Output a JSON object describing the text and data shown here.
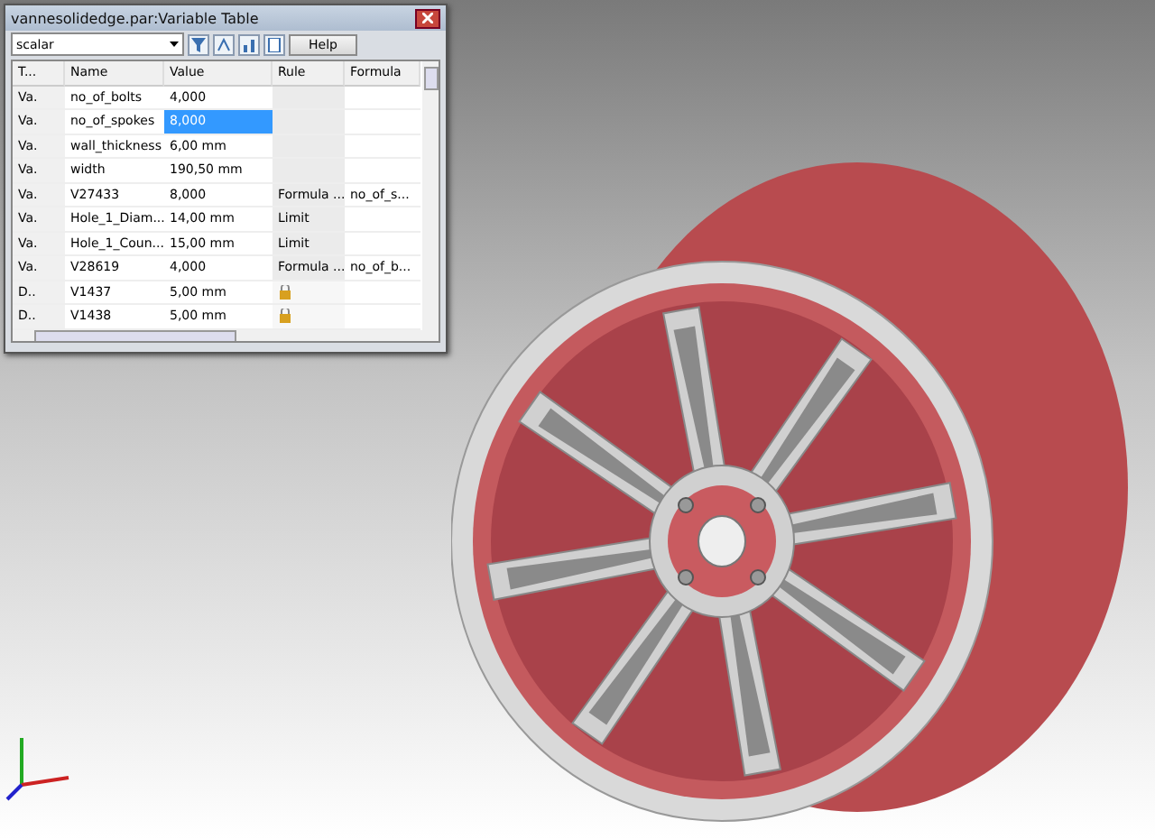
{
  "window": {
    "title": "vannesolidedge.par:Variable Table"
  },
  "toolbar": {
    "filter": "scalar",
    "help": "Help"
  },
  "table": {
    "columns": [
      "T...",
      "Name",
      "Value",
      "Rule",
      "Formula"
    ],
    "rows": [
      {
        "type": "Va.",
        "name": "no_of_bolts",
        "value": "4,000",
        "rule": "",
        "formula": "",
        "selected": false,
        "locked": false
      },
      {
        "type": "Va.",
        "name": "no_of_spokes",
        "value": "8,000",
        "rule": "",
        "formula": "",
        "selected": true,
        "locked": false
      },
      {
        "type": "Va.",
        "name": "wall_thickness",
        "value": "6,00 mm",
        "rule": "",
        "formula": "",
        "selected": false,
        "locked": false
      },
      {
        "type": "Va.",
        "name": "width",
        "value": "190,50 mm",
        "rule": "",
        "formula": "",
        "selected": false,
        "locked": false
      },
      {
        "type": "Va.",
        "name": "V27433",
        "value": "8,000",
        "rule": "Formula ...",
        "formula": "no_of_s...",
        "selected": false,
        "locked": false
      },
      {
        "type": "Va.",
        "name": "Hole_1_Diam...",
        "value": "14,00 mm",
        "rule": "Limit",
        "formula": "",
        "selected": false,
        "locked": false
      },
      {
        "type": "Va.",
        "name": "Hole_1_Coun...",
        "value": "15,00 mm",
        "rule": "Limit",
        "formula": "",
        "selected": false,
        "locked": false
      },
      {
        "type": "Va.",
        "name": "V28619",
        "value": "4,000",
        "rule": "Formula ...",
        "formula": "no_of_b...",
        "selected": false,
        "locked": false
      },
      {
        "type": "D..",
        "name": "V1437",
        "value": "5,00 mm",
        "rule": "",
        "formula": "",
        "selected": false,
        "locked": true
      },
      {
        "type": "D..",
        "name": "V1438",
        "value": "5,00 mm",
        "rule": "",
        "formula": "",
        "selected": false,
        "locked": true
      }
    ]
  }
}
